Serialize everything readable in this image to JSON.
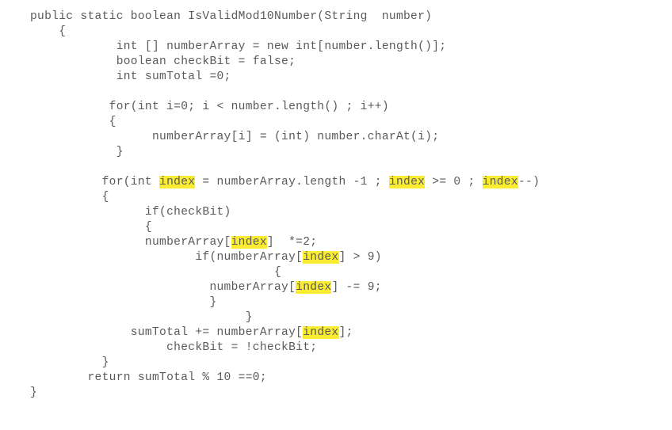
{
  "code": {
    "l01a": "public static boolean IsValidMod10Number(String  number)",
    "l02a": "    {",
    "l03a": "            int [] numberArray = new int[number.length()];",
    "l04a": "            boolean checkBit = false;",
    "l05a": "            int sumTotal =0;",
    "blank1": "",
    "l06a": "           for(int i=0; i < number.length() ; i++)",
    "l07a": "           {",
    "l08a": "                 numberArray[i] = (int) number.charAt(i);",
    "l09a": "            }",
    "blank2": "",
    "l10a": "          for(int ",
    "l10hl1": "index",
    "l10b": " = numberArray.length -1 ; ",
    "l10hl2": "index",
    "l10c": " >= 0 ; ",
    "l10hl3": "index",
    "l10d": "--)",
    "l11a": "          {",
    "l12a": "                if(checkBit)",
    "l13a": "                {",
    "l14a": "                numberArray[",
    "l14hl1": "index",
    "l14b": "]  *=2;",
    "l15a": "                       if(numberArray[",
    "l15hl1": "index",
    "l15b": "] > 9)",
    "l16a": "                                  {",
    "l17a": "                         numberArray[",
    "l17hl1": "index",
    "l17b": "] -= 9;",
    "l18a": "                         }",
    "l19a": "                              }",
    "l20a": "              sumTotal += numberArray[",
    "l20hl1": "index",
    "l20b": "];",
    "l21a": "                   checkBit = !checkBit;",
    "l22a": "          }",
    "l23a": "        return sumTotal % 10 ==0;",
    "l24a": "}"
  }
}
